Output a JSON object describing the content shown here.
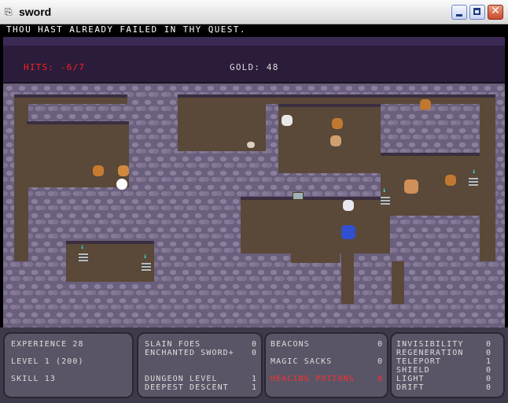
{
  "window": {
    "title": "sword",
    "app_icon": "scroll-icon",
    "minimize_icon": "minimize-icon",
    "maximize_icon": "maximize-icon",
    "close_icon": "close-icon",
    "close_glyph": "✕"
  },
  "message": "THOU HAST ALREADY FAILED IN THY QUEST.",
  "status": {
    "hits": "HITS: -6/7",
    "gold": "GOLD: 48",
    "hits_color": "#ff1e1e"
  },
  "stats_left": {
    "experience": "EXPERIENCE 28",
    "level": "LEVEL 1 (200)",
    "skill": "SKILL 13"
  },
  "stats_mid": [
    {
      "label": "SLAIN FOES",
      "value": "0"
    },
    {
      "label": "ENCHANTED SWORD+",
      "value": "0"
    },
    {
      "label": "DUNGEON LEVEL",
      "value": "1"
    },
    {
      "label": "DEEPEST DESCENT",
      "value": "1"
    }
  ],
  "inventory": [
    {
      "label": "BEACONS",
      "value": "0"
    },
    {
      "label": "MAGIC SACKS",
      "value": "0"
    },
    {
      "label": "HEALING POTIONS",
      "value": "0",
      "color": "#ff2e2e"
    }
  ],
  "spells": [
    {
      "label": "INVISIBILITY",
      "value": "0"
    },
    {
      "label": "REGENERATION",
      "value": "0"
    },
    {
      "label": "TELEPORT",
      "value": "1"
    },
    {
      "label": "SHIELD",
      "value": "0"
    },
    {
      "label": "LIGHT",
      "value": "0"
    },
    {
      "label": "DRIFT",
      "value": "0"
    }
  ],
  "colors": {
    "floor": "#5a4838",
    "wall": "#6a5f7c",
    "hud": "#2a1c3a"
  }
}
